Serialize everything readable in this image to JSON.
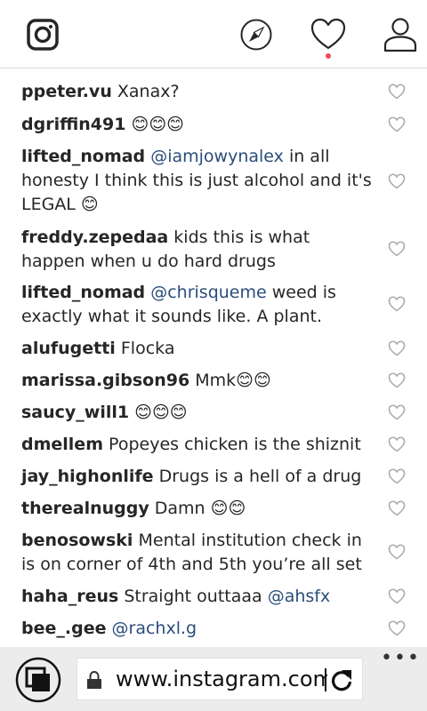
{
  "nav": {
    "icons": [
      "instagram-icon",
      "explore-icon",
      "activity-heart-icon",
      "profile-icon"
    ],
    "notification_dot_color": "#ed4956"
  },
  "comments": [
    {
      "user": "ppeter.vu",
      "parts": [
        {
          "t": " Xanax?",
          "m": false
        }
      ]
    },
    {
      "user": "dgriffin491",
      "parts": [
        {
          "t": " 😊😊😊",
          "m": false
        }
      ]
    },
    {
      "user": "lifted_nomad",
      "parts": [
        {
          "t": " ",
          "m": false
        },
        {
          "t": "@iamjowynalex",
          "m": true
        },
        {
          "t": " in all honesty I think this is just alcohol and it's LEGAL 😊",
          "m": false
        }
      ]
    },
    {
      "user": "freddy.zepedaa",
      "parts": [
        {
          "t": " kids this is what happen when u do hard drugs",
          "m": false
        }
      ]
    },
    {
      "user": "lifted_nomad",
      "parts": [
        {
          "t": " ",
          "m": false
        },
        {
          "t": "@chrisqueme",
          "m": true
        },
        {
          "t": " weed is exactly what it sounds like. A plant.",
          "m": false
        }
      ]
    },
    {
      "user": "alufugetti",
      "parts": [
        {
          "t": " Flocka",
          "m": false
        }
      ]
    },
    {
      "user": "marissa.gibson96",
      "parts": [
        {
          "t": " Mmk😊😊",
          "m": false
        }
      ]
    },
    {
      "user": "saucy_will1",
      "parts": [
        {
          "t": " 😊😊😊",
          "m": false
        }
      ]
    },
    {
      "user": "dmellem",
      "parts": [
        {
          "t": " Popeyes chicken is the shiznit",
          "m": false
        }
      ]
    },
    {
      "user": "jay_highonlife",
      "parts": [
        {
          "t": " Drugs is a hell of a drug",
          "m": false
        }
      ]
    },
    {
      "user": "therealnuggy",
      "parts": [
        {
          "t": " Damn 😊😊",
          "m": false
        }
      ]
    },
    {
      "user": "benosowski",
      "parts": [
        {
          "t": " Mental institution check in is on corner of 4th and 5th you’re all set",
          "m": false
        }
      ]
    },
    {
      "user": "haha_reus",
      "parts": [
        {
          "t": " Straight outtaaa ",
          "m": false
        },
        {
          "t": "@ahsfx",
          "m": true
        }
      ]
    },
    {
      "user": "bee_.gee",
      "parts": [
        {
          "t": " ",
          "m": false
        },
        {
          "t": "@rachxl.g",
          "m": true
        }
      ]
    }
  ],
  "browser": {
    "url": "www.instagram.com/",
    "more_label": "•••",
    "icons": [
      "tabs-icon",
      "lock-icon",
      "refresh-icon",
      "more-icon"
    ]
  }
}
